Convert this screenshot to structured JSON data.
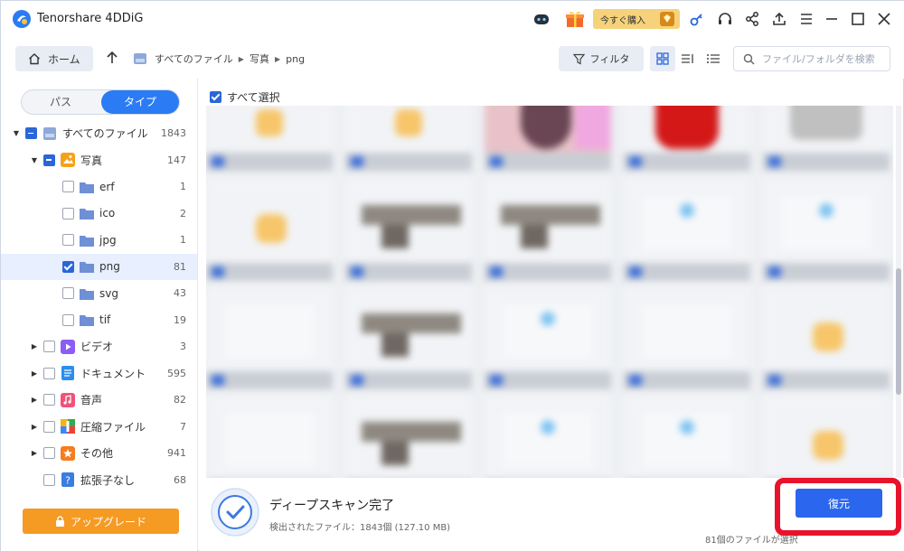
{
  "app": {
    "title": "Tenorshare 4DDiG"
  },
  "titlebar": {
    "buy_label": "今すぐ購入"
  },
  "toolbar": {
    "home_label": "ホーム",
    "breadcrumb": [
      "すべてのファイル",
      "写真",
      "png"
    ],
    "filter_label": "フィルタ",
    "search_placeholder": "ファイル/フォルダを検索"
  },
  "sidebar": {
    "tabs": [
      "パス",
      "タイプ"
    ],
    "active_tab": "タイプ",
    "tree": [
      {
        "label": "すべてのファイル",
        "count": "1843"
      },
      {
        "label": "写真",
        "count": "147"
      },
      {
        "label": "erf",
        "count": "1"
      },
      {
        "label": "ico",
        "count": "2"
      },
      {
        "label": "jpg",
        "count": "1"
      },
      {
        "label": "png",
        "count": "81"
      },
      {
        "label": "svg",
        "count": "43"
      },
      {
        "label": "tif",
        "count": "19"
      },
      {
        "label": "ビデオ",
        "count": "3"
      },
      {
        "label": "ドキュメント",
        "count": "595"
      },
      {
        "label": "音声",
        "count": "82"
      },
      {
        "label": "圧縮ファイル",
        "count": "7"
      },
      {
        "label": "その他",
        "count": "941"
      },
      {
        "label": "拡張子なし",
        "count": "68"
      }
    ],
    "upgrade_label": "アップグレード"
  },
  "content": {
    "select_all_label": "すべて選択",
    "status_title": "ディープスキャン完了",
    "status_sub": "検出されたファイル：1843個 (127.10 MB)",
    "restore_label": "復元",
    "selected_count": "81個のファイルが選択"
  },
  "colors": {
    "accent": "#2a66ee",
    "upgrade": "#f59a23",
    "highlight": "#e8132b"
  }
}
